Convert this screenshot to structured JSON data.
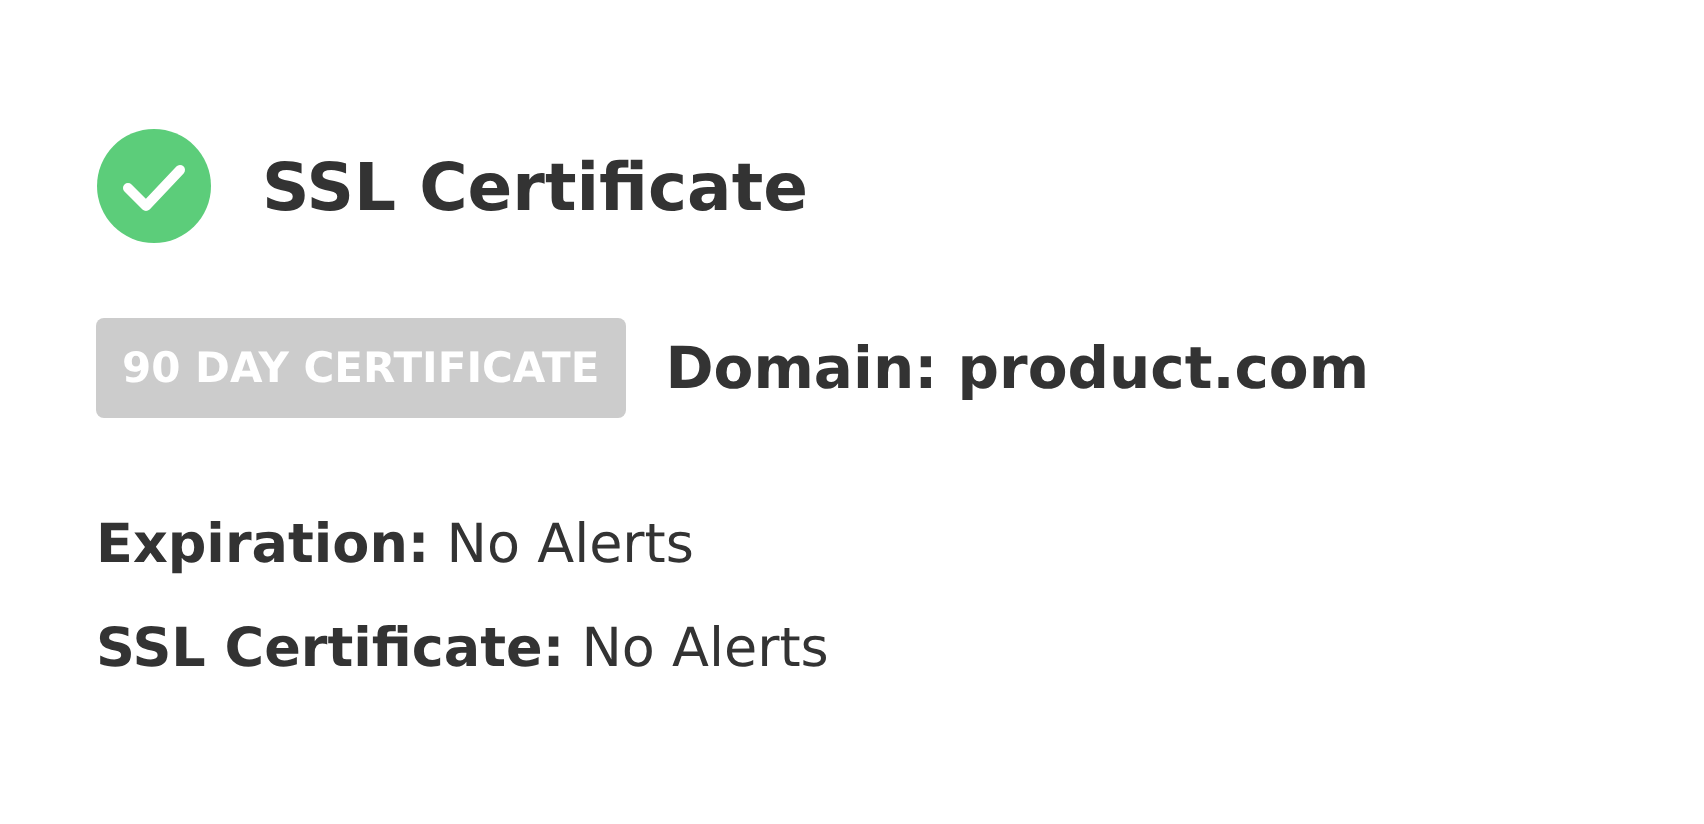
{
  "certificate": {
    "title": "SSL Certificate",
    "verified": true,
    "badge": "90 DAY CERTIFICATE",
    "domain": "Domain: product.com",
    "details": [
      "**Expiration:** No Alerts",
      "**SSL Certificate:** No Alerts"
    ]
  }
}
